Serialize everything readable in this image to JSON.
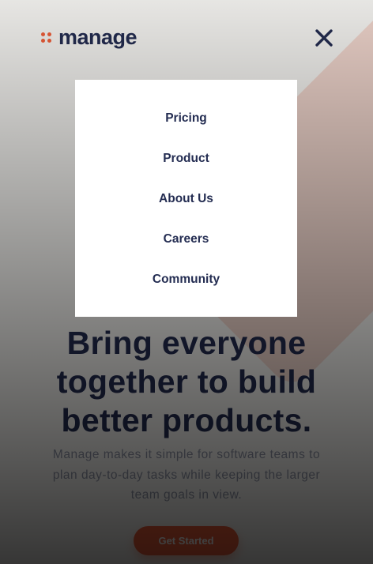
{
  "brand": {
    "logo_text": "manage",
    "accent": "#f25f3a",
    "primary": "#242d52"
  },
  "header": {
    "close_icon": "close-icon"
  },
  "menu": {
    "items": [
      {
        "label": "Pricing"
      },
      {
        "label": "Product"
      },
      {
        "label": "About Us"
      },
      {
        "label": "Careers"
      },
      {
        "label": "Community"
      }
    ]
  },
  "hero": {
    "title": "Bring everyone together to build better products.",
    "text": "Manage makes it simple for software teams to plan day-to-day tasks while keeping the larger team goals in view.",
    "cta_label": "Get Started"
  }
}
